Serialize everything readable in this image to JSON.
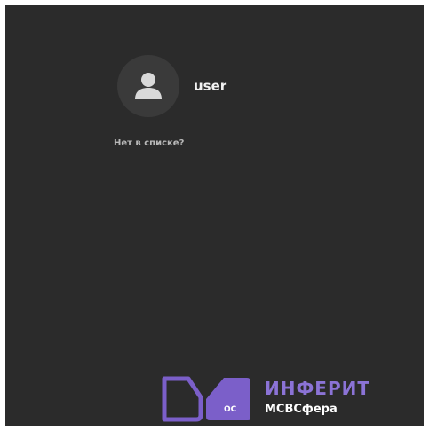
{
  "user_list": {
    "users": [
      {
        "name": "user",
        "avatar_icon": "user-silhouette-icon"
      }
    ],
    "not_listed_label": "Нет в списке?"
  },
  "branding": {
    "name": "ИНФЕРИТ",
    "subtitle": "МСВСфера",
    "badge": "ОС",
    "accent_color": "#7b5fc9"
  },
  "colors": {
    "background": "#2b2b2b",
    "avatar_bg": "#3a3a3a"
  }
}
